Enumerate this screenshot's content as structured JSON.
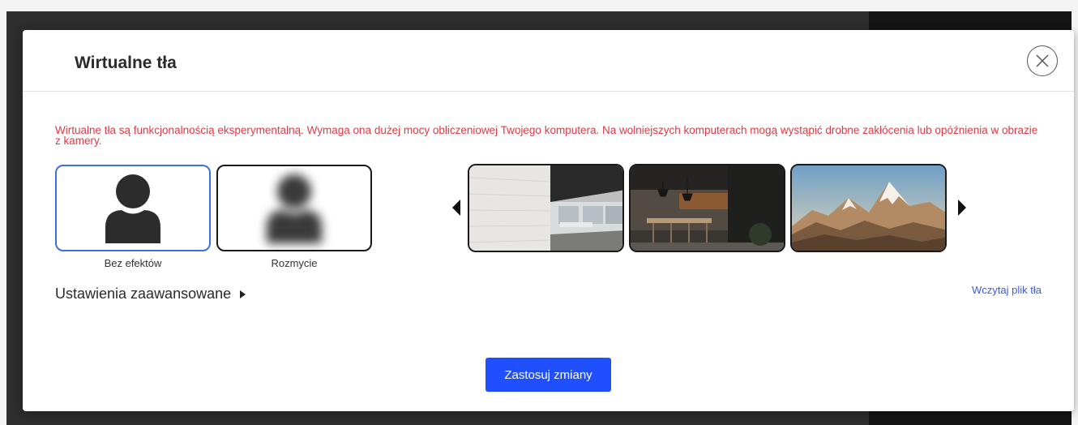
{
  "dialog": {
    "title": "Wirtualne tła",
    "warning": "Wirtualne tła są funkcjonalnością eksperymentalną. Wymaga ona dużej mocy obliczeniowej Twojego komputera. Na wolniejszych komputerach mogą wystąpić drobne zakłócenia lub opóźnienia w obrazie z kamery."
  },
  "effects": [
    {
      "label": "Bez efektów",
      "selected": true,
      "icon": "person-icon"
    },
    {
      "label": "Rozmycie",
      "selected": false,
      "icon": "person-blurred-icon"
    }
  ],
  "backgrounds": [
    {
      "icon": "office-background-thumbnail"
    },
    {
      "icon": "kitchen-background-thumbnail"
    },
    {
      "icon": "mountains-background-thumbnail"
    }
  ],
  "advanced": {
    "label": "Ustawienia zaawansowane"
  },
  "upload": {
    "label": "Wczytaj plik tła"
  },
  "apply": {
    "label": "Zastosuj zmiany"
  },
  "colors": {
    "accent": "#1f4fff",
    "warning": "#e03a44",
    "link": "#3b5bdb",
    "selected_border": "#3d6fe0"
  }
}
